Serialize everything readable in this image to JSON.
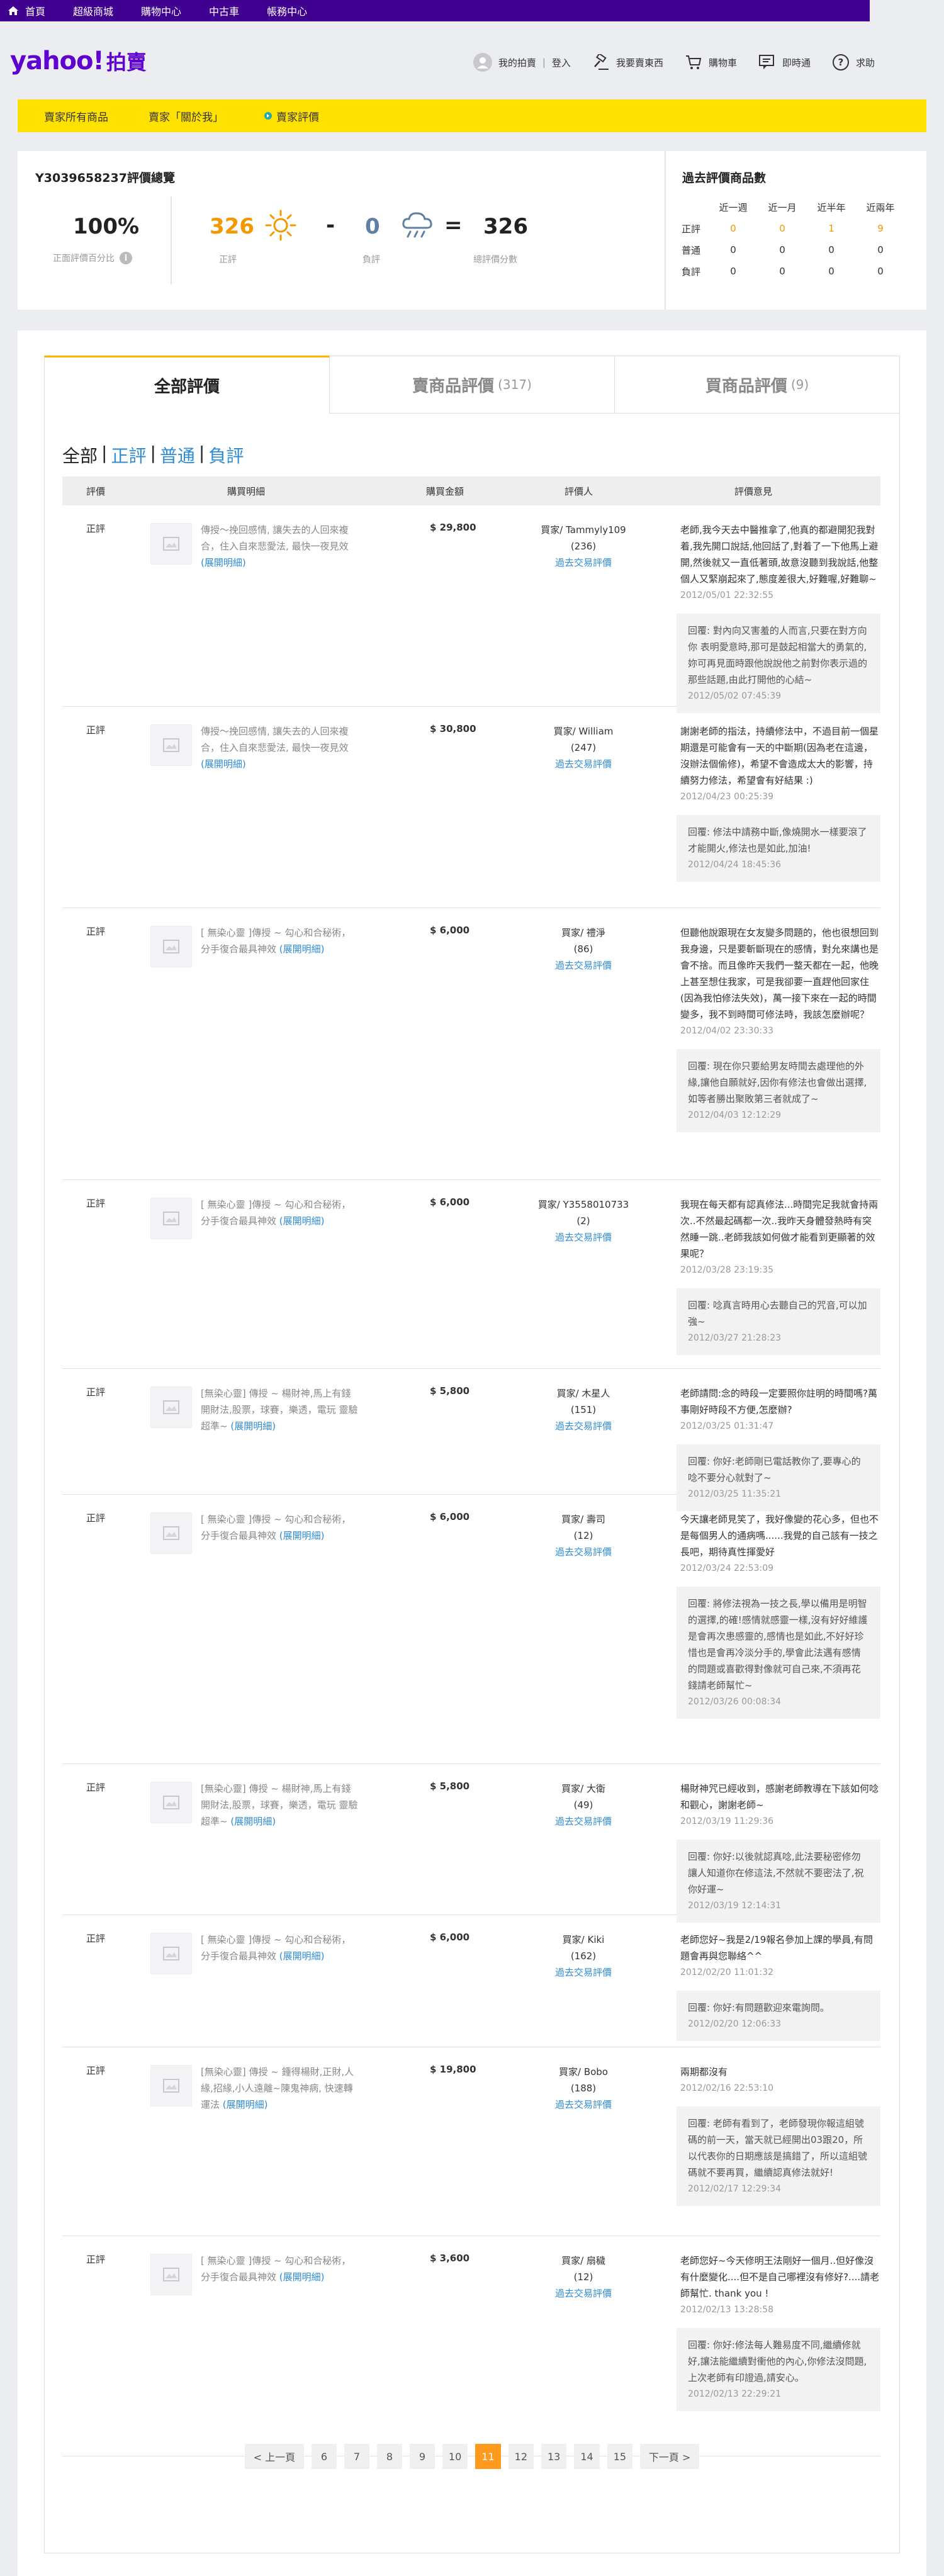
{
  "topbar": {
    "items": [
      "首頁",
      "超級商城",
      "購物中心",
      "中古車",
      "帳務中心"
    ]
  },
  "header": {
    "logo_text": "yahoo!",
    "logo_sub": "拍賣",
    "my_auction": "我的拍賣",
    "login": "登入",
    "sell": "我要賣東西",
    "cart": "購物車",
    "messenger": "即時通",
    "help": "求助"
  },
  "subnav": {
    "items": [
      "賣家所有商品",
      "賣家「關於我」",
      "賣家評價"
    ]
  },
  "summary": {
    "title": "Y3039658237評價總覽",
    "pct": "100%",
    "pct_label": "正面評價百分比",
    "positive": "326",
    "positive_label": "正評",
    "minus": "-",
    "negative": "0",
    "negative_label": "負評",
    "equals": "=",
    "total": "326",
    "total_label": "總評價分數",
    "info": "i"
  },
  "history": {
    "title": "過去評價商品數",
    "headers": [
      "近一週",
      "近一月",
      "近半年",
      "近兩年"
    ],
    "rows": [
      {
        "label": "正評",
        "values": [
          "0",
          "0",
          "1",
          "9"
        ]
      },
      {
        "label": "普通",
        "values": [
          "0",
          "0",
          "0",
          "0"
        ]
      },
      {
        "label": "負評",
        "values": [
          "0",
          "0",
          "0",
          "0"
        ]
      }
    ]
  },
  "tabs": [
    {
      "label": "全部評價",
      "count": ""
    },
    {
      "label": "賣商品評價",
      "count": "(317)"
    },
    {
      "label": "買商品評價",
      "count": "(9)"
    }
  ],
  "filters": {
    "all": "全部",
    "pos": "正評",
    "neutral": "普通",
    "neg": "負評",
    "sep": "|"
  },
  "table_headers": {
    "type": "評價",
    "item": "購買明細",
    "amount": "購買金額",
    "rater": "評價人",
    "comment": "評價意見"
  },
  "more_label": "(展開明細)",
  "history_link": "過去交易評價",
  "reviews": [
    {
      "type": "正評",
      "item": "傳授～挽回感情, 讓失去的人回來複合，住入自來悲愛法, 最快一夜見效",
      "amount": "$ 29,800",
      "rater": "買家/ Tammyly109",
      "rater_count": "(236)",
      "comment": "老師,我今天去中醫推拿了,他真的都避開犯我對着,我先開口說話,他回話了,對着了一下他馬上避開,然後就又一直低著頭,故意沒聽到我說話,他整個人又緊崩起來了,態度差很大,好難喔,好難聊~",
      "date": "2012/05/01 22:32:55",
      "reply": "回覆: 對內向又害羞的人而言,只要在對方向你 表明愛意時,那可是鼓起相當大的勇氣的,妳可再見面時跟他說說他之前對你表示過的那些話題,由此打開他的心結~",
      "reply_date": "2012/05/02 07:45:39"
    },
    {
      "type": "正評",
      "item": "傳授～挽回感情, 讓失去的人回來複合，住入自來悲愛法, 最快一夜見效",
      "amount": "$ 30,800",
      "rater": "買家/ William",
      "rater_count": "(247)",
      "comment": "謝謝老師的指法，持續修法中，不過目前一個星期還是可能會有一天的中斷期(因為老在這邊，沒辦法個偷修)，希望不會造成太大的影響，持續努力修法，希望會有好結果 :)",
      "date": "2012/04/23 00:25:39",
      "reply": "回覆: 修法中請務中斷,像燒開水一樣要滾了才能開火,修法也是如此,加油!",
      "reply_date": "2012/04/24 18:45:36"
    },
    {
      "type": "正評",
      "item": "[ 無染心靈 ]傳授 ~ 勾心和合秘術，分手復合最具神效",
      "amount": "$ 6,000",
      "rater": "買家/ 禮淨",
      "rater_count": "(86)",
      "comment": "但聽他說跟現在女友變多問題的，他也很想回到我身邊，只是要斬斷現在的感情，對允來講也是會不捨。而且像昨天我們一整天都在一起，他晚上甚至想住我家，可是我卻要一直趕他回家住(因為我怕修法失效)，萬一接下來在一起的時間變多，我不到時間可修法時，我該怎麼辦呢？",
      "date": "2012/04/02 23:30:33",
      "reply": "回覆: 現在你只要給男友時間去處理他的外緣,讓他自願就好,因你有修法也會做出選擇,如等者勝出聚敗第三者就成了~",
      "reply_date": "2012/04/03 12:12:29"
    },
    {
      "type": "正評",
      "item": "[ 無染心靈 ]傳授 ~ 勾心和合秘術，分手復合最具神效",
      "amount": "$ 6,000",
      "rater": "買家/ Y3558010733",
      "rater_count": "(2)",
      "comment": "我現在每天都有認真修法...時間完足我就會持兩次..不然最起碼都一次..我昨天身體發熱時有突然睡一跳..老師我該如何做才能看到更顯著的效果呢？",
      "date": "2012/03/28 23:19:35",
      "reply": "回覆: 唸真言時用心去聽自己的咒音,可以加強~",
      "reply_date": "2012/03/27 21:28:23"
    },
    {
      "type": "正評",
      "item": "[無染心靈] 傳授 ~ 楊財神,馬上有錢開財法,股票，球賽，樂透，電玩 靈驗超準~",
      "amount": "$ 5,800",
      "rater": "買家/ 木星人",
      "rater_count": "(151)",
      "comment": "老師請問:念的時段一定要照你註明的時間嗎?萬事剛好時段不方便,怎麼辦?",
      "date": "2012/03/25 01:31:47",
      "reply": "回覆: 你好:老師剛已電話教你了,要專心的唸不要分心就對了~",
      "reply_date": "2012/03/25 11:35:21"
    },
    {
      "type": "正評",
      "item": "[ 無染心靈 ]傳授 ~ 勾心和合秘術，分手復合最具神效",
      "amount": "$ 6,000",
      "rater": "買家/ 壽司",
      "rater_count": "(12)",
      "comment": "今天讓老師見笑了，我好像變的花心多，但也不是每個男人的通病嗎......我覺的自己該有一技之長吧，期待真性揮愛好",
      "date": "2012/03/24 22:53:09",
      "reply": "回覆: 將修法視為一技之長,學以備用是明智的選擇,的確!感情就感靈一樣,沒有好好維護是會再次患感靈的,感情也是如此,不好好珍惜也是會再冷淡分手的,學會此法遇有感情的問題或喜歡得對像就可自己來,不須再花錢請老師幫忙~",
      "reply_date": "2012/03/26 00:08:34"
    },
    {
      "type": "正評",
      "item": "[無染心靈] 傳授 ~ 楊財神,馬上有錢開財法,股票，球賽，樂透，電玩 靈驗超準~",
      "amount": "$ 5,800",
      "rater": "買家/ 大衛",
      "rater_count": "(49)",
      "comment": "楊財神咒已經收到，感謝老師教導在下該如何唸和觀心，謝謝老師~",
      "date": "2012/03/19 11:29:36",
      "reply": "回覆: 你好:以後就認真唸,此法要秘密修勿讓人知道你在修這法,不然就不要密法了,祝你好運~",
      "reply_date": "2012/03/19 12:14:31"
    },
    {
      "type": "正評",
      "item": "[ 無染心靈 ]傳授 ~ 勾心和合秘術，分手復合最具神效",
      "amount": "$ 6,000",
      "rater": "買家/ Kiki",
      "rater_count": "(162)",
      "comment": "老師您好~我是2/19報名參加上課的學員,有問題會再與您聯絡^^",
      "date": "2012/02/20 11:01:32",
      "reply": "回覆: 你好:有問題歡迎來電詢問。",
      "reply_date": "2012/02/20 12:06:33"
    },
    {
      "type": "正評",
      "item": "[無染心靈] 傳授 ~ 鍾得楊財,正財,人緣,招緣,小人遠離~陳鬼神病, 快速轉運法",
      "amount": "$ 19,800",
      "rater": "買家/ Bobo",
      "rater_count": "(188)",
      "comment": "兩期都沒有",
      "date": "2012/02/16 22:53:10",
      "reply": "回覆: 老師有看到了，老師發現你報這組號碼的前一天，當天就已經開出03跟20，所以代表你的日期應該是搞錯了，所以這組號碼就不要再買，繼續認真修法就好!",
      "reply_date": "2012/02/17 12:29:34"
    },
    {
      "type": "正評",
      "item": "[ 無染心靈 ]傳授 ~ 勾心和合秘術，分手復合最具神效",
      "amount": "$ 3,600",
      "rater": "買家/ 扇穢",
      "rater_count": "(12)",
      "comment": "老師您好~今天修明王法剛好一個月..但好像沒有什麼變化....但不是自己哪裡沒有修好?....請老師幫忙. thank you !",
      "date": "2012/02/13 13:28:58",
      "reply": "回覆: 你好:修法每人難易度不同,繼續修就好,讓法能繼續對衝他的內心,你修法沒問題,上次老師有印證過,請安心。",
      "reply_date": "2012/02/13 22:29:21"
    }
  ],
  "pager": {
    "prev": "< 上一頁",
    "pages": [
      "6",
      "7",
      "8",
      "9",
      "10",
      "11",
      "12",
      "13",
      "14",
      "15"
    ],
    "current": "11",
    "next": "下一頁 >"
  }
}
